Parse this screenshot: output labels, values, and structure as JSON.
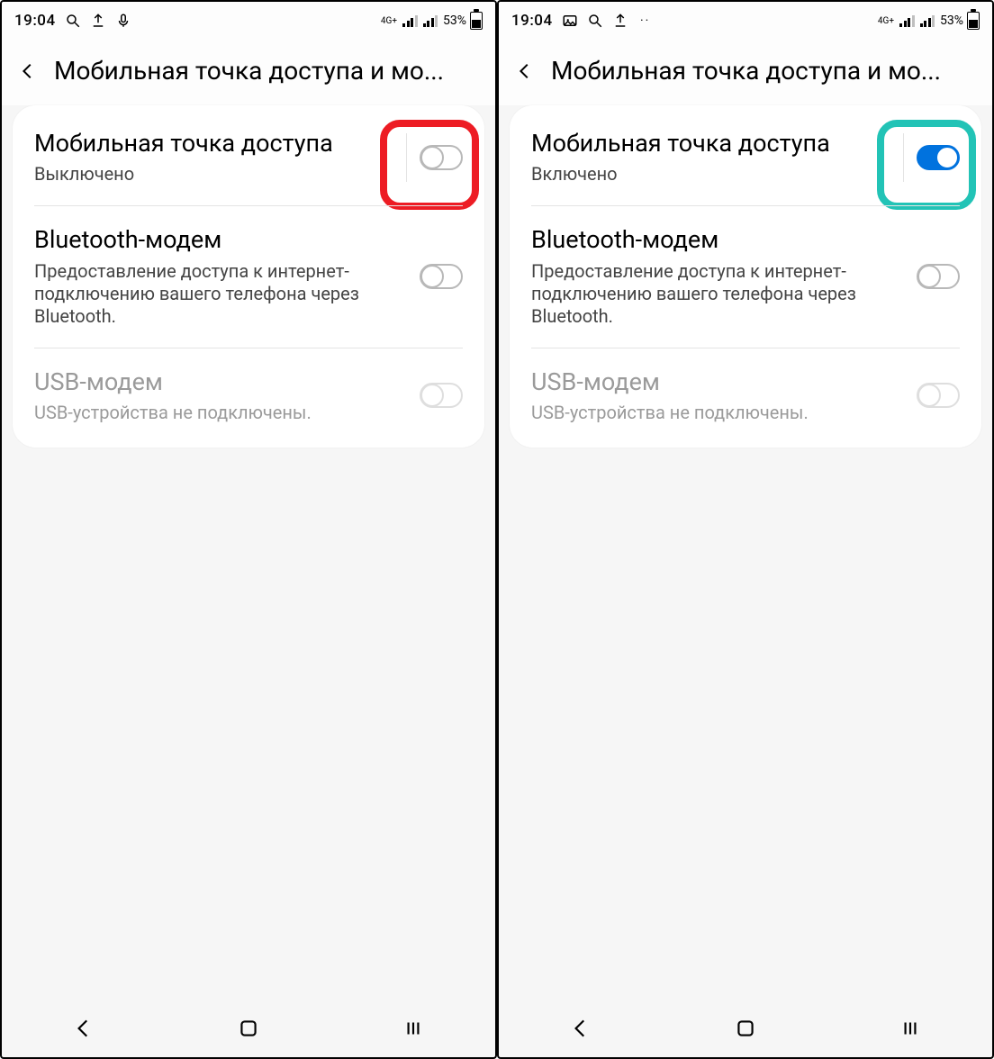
{
  "screens": [
    {
      "status": {
        "time": "19:04",
        "icons": [
          "search",
          "upload",
          "mic"
        ],
        "net": "4G+",
        "battery_pct": "53%"
      },
      "header": {
        "title": "Мобильная точка доступа и мо..."
      },
      "rows": {
        "hotspot": {
          "title": "Мобильная точка доступа",
          "sub": "Выключено",
          "on": false
        },
        "bt": {
          "title": "Bluetooth-модем",
          "sub": "Предоставление доступа к интернет-подключению вашего телефона через Bluetooth.",
          "on": false
        },
        "usb": {
          "title": "USB-модем",
          "sub": "USB-устройства не подключены.",
          "on": false,
          "disabled": true
        }
      },
      "highlight": "red"
    },
    {
      "status": {
        "time": "19:04",
        "icons": [
          "image",
          "search",
          "upload",
          "more"
        ],
        "net": "4G+",
        "battery_pct": "53%"
      },
      "header": {
        "title": "Мобильная точка доступа и мо..."
      },
      "rows": {
        "hotspot": {
          "title": "Мобильная точка доступа",
          "sub": "Включено",
          "on": true
        },
        "bt": {
          "title": "Bluetooth-модем",
          "sub": "Предоставление доступа к интернет-подключению вашего телефона через Bluetooth.",
          "on": false
        },
        "usb": {
          "title": "USB-модем",
          "sub": "USB-устройства не подключены.",
          "on": false,
          "disabled": true
        }
      },
      "highlight": "teal"
    }
  ]
}
